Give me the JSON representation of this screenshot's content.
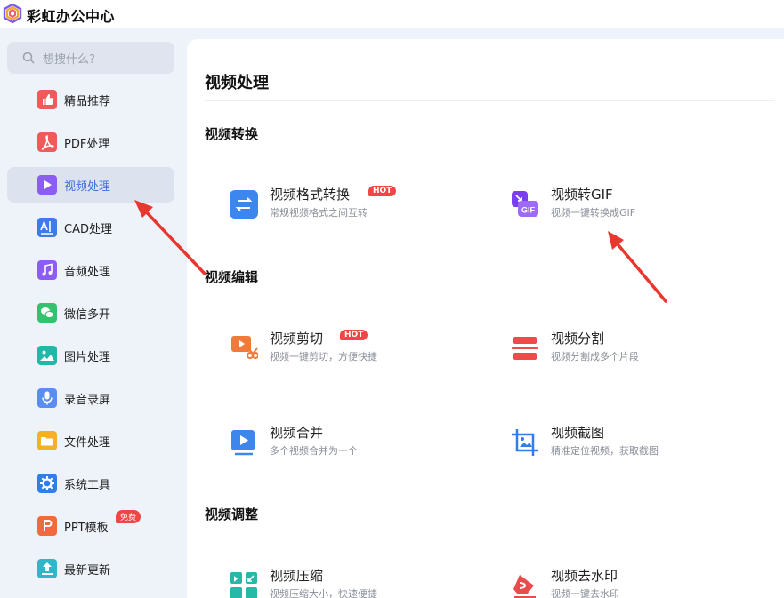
{
  "app": {
    "title": "彩虹办公中心",
    "logo_icon": "rainbow-hexagon-logo"
  },
  "search": {
    "placeholder": "想搜什么?"
  },
  "sidebar": {
    "items": [
      {
        "label": "精品推荐",
        "icon": "thumbs-up-icon",
        "color": "#ef5a5a"
      },
      {
        "label": "PDF处理",
        "icon": "pdf-icon",
        "color": "#ef5a5a"
      },
      {
        "label": "视频处理",
        "icon": "play-icon",
        "color": "#8b5cf6",
        "active": true
      },
      {
        "label": "CAD处理",
        "icon": "cad-icon",
        "color": "#3d7be8"
      },
      {
        "label": "音频处理",
        "icon": "music-icon",
        "color": "#8b5cf6"
      },
      {
        "label": "微信多开",
        "icon": "wechat-icon",
        "color": "#34c26e"
      },
      {
        "label": "图片处理",
        "icon": "image-icon",
        "color": "#20b8a6"
      },
      {
        "label": "录音录屏",
        "icon": "microphone-icon",
        "color": "#5b8cf0"
      },
      {
        "label": "文件处理",
        "icon": "folder-icon",
        "color": "#f5b025"
      },
      {
        "label": "系统工具",
        "icon": "gear-icon",
        "color": "#2f7fe6"
      },
      {
        "label": "PPT模板",
        "icon": "ppt-icon",
        "color": "#f06a3c",
        "badge": "免费"
      },
      {
        "label": "最新更新",
        "icon": "upload-icon",
        "color": "#2fb6c8"
      }
    ]
  },
  "main": {
    "title": "视频处理",
    "sections": [
      {
        "title": "视频转换",
        "tools": [
          {
            "name": "视频格式转换",
            "desc": "常规视频格式之间互转",
            "badge": "HOT",
            "icon": "swap-arrows-icon"
          },
          {
            "name": "视频转GIF",
            "desc": "视频一键转换成GIF",
            "icon": "gif-icon"
          }
        ]
      },
      {
        "title": "视频编辑",
        "tools": [
          {
            "name": "视频剪切",
            "desc": "视频一键剪切，方便快捷",
            "badge": "HOT",
            "icon": "video-scissors-icon"
          },
          {
            "name": "视频分割",
            "desc": "视频分割成多个片段",
            "icon": "split-icon"
          },
          {
            "name": "视频合并",
            "desc": "多个视频合并为一个",
            "icon": "merge-play-icon"
          },
          {
            "name": "视频截图",
            "desc": "精准定位视频，获取截图",
            "icon": "crop-image-icon"
          }
        ]
      },
      {
        "title": "视频调整",
        "tools": [
          {
            "name": "视频压缩",
            "desc": "视频压缩大小，快速便捷",
            "icon": "compress-icon"
          },
          {
            "name": "视频去水印",
            "desc": "视频一键去水印",
            "icon": "eraser-icon"
          }
        ]
      }
    ]
  },
  "colors": {
    "accent": "#3d6fe0",
    "hot_badge": "#f04646",
    "annotation_arrow": "#e8372e"
  }
}
